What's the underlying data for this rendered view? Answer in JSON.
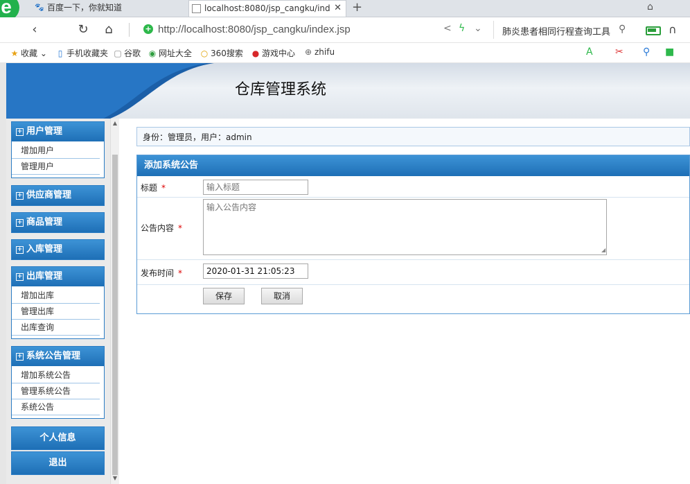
{
  "browser": {
    "tabs": [
      {
        "title": "百度一下，你就知道",
        "icon": "paw-icon"
      },
      {
        "title": "localhost:8080/jsp_cangku/ind",
        "icon": "page-icon",
        "close": "✕"
      }
    ],
    "new_tab": "+",
    "url": "http://localhost:8080/jsp_cangku/index.jsp",
    "search_text": "肺炎患者相同行程查询工具",
    "bookmarks": [
      "收藏",
      "手机收藏夹",
      "谷歌",
      "网址大全",
      "360搜索",
      "游戏中心",
      "zhifu"
    ]
  },
  "header": {
    "title": "仓库管理系统"
  },
  "sidebar": {
    "groups": [
      {
        "label": "用户管理",
        "items": [
          "增加用户",
          "管理用户"
        ]
      },
      {
        "label": "供应商管理",
        "items": []
      },
      {
        "label": "商品管理",
        "items": []
      },
      {
        "label": "入库管理",
        "items": []
      },
      {
        "label": "出库管理",
        "items": [
          "增加出库",
          "管理出库",
          "出库查询"
        ]
      },
      {
        "label": "系统公告管理",
        "items": [
          "增加系统公告",
          "管理系统公告",
          "系统公告"
        ]
      }
    ],
    "buttons": [
      "个人信息",
      "退出"
    ]
  },
  "identity": {
    "text": "身份：管理员，用户：admin"
  },
  "form": {
    "title": "添加系统公告",
    "required_mark": "*",
    "fields": {
      "title": {
        "label": "标题",
        "placeholder": "输入标题"
      },
      "content": {
        "label": "公告内容",
        "placeholder": "输入公告内容"
      },
      "publish_time": {
        "label": "发布时间",
        "value": "2020-01-31 21:05:23"
      }
    },
    "save_label": "保存",
    "cancel_label": "取消"
  },
  "colors": {
    "accent": "#1e6fb6",
    "required": "#dd0000"
  }
}
